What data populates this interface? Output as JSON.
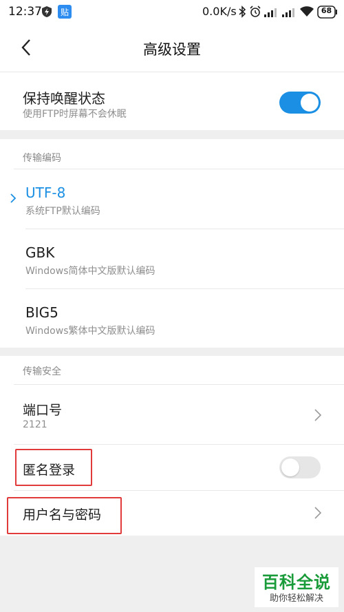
{
  "status_bar": {
    "time": "12:37",
    "net_speed": "0.0K/s",
    "battery": "68",
    "icons": [
      "shield-icon",
      "notification-badge-icon",
      "bluetooth-icon",
      "alarm-icon",
      "signal-icon",
      "signal-icon",
      "wifi-icon",
      "battery-icon"
    ]
  },
  "header": {
    "title": "高级设置",
    "back_icon": "back-arrow-icon"
  },
  "keep_awake": {
    "title": "保持唤醒状态",
    "subtitle": "使用FTP时屏幕不会休眠",
    "enabled": true
  },
  "encoding": {
    "header": "传输编码",
    "selected_index": 0,
    "accent": "#1a8fe3",
    "options": [
      {
        "name": "UTF-8",
        "desc": "系统FTP默认编码"
      },
      {
        "name": "GBK",
        "desc": "Windows简体中文版默认编码"
      },
      {
        "name": "BIG5",
        "desc": "Windows繁体中文版默认编码"
      }
    ]
  },
  "security": {
    "header": "传输安全",
    "port": {
      "title": "端口号",
      "value": "2121"
    },
    "anonymous": {
      "title": "匿名登录",
      "enabled": false
    },
    "credentials": {
      "title": "用户名与密码"
    }
  },
  "colors": {
    "toggle_on": "#1a8fe3",
    "toggle_off": "#e6e6e6",
    "highlight_box": "#e03a3a"
  },
  "watermark": {
    "title": "百科全说",
    "subtitle": "助你轻松解决"
  }
}
